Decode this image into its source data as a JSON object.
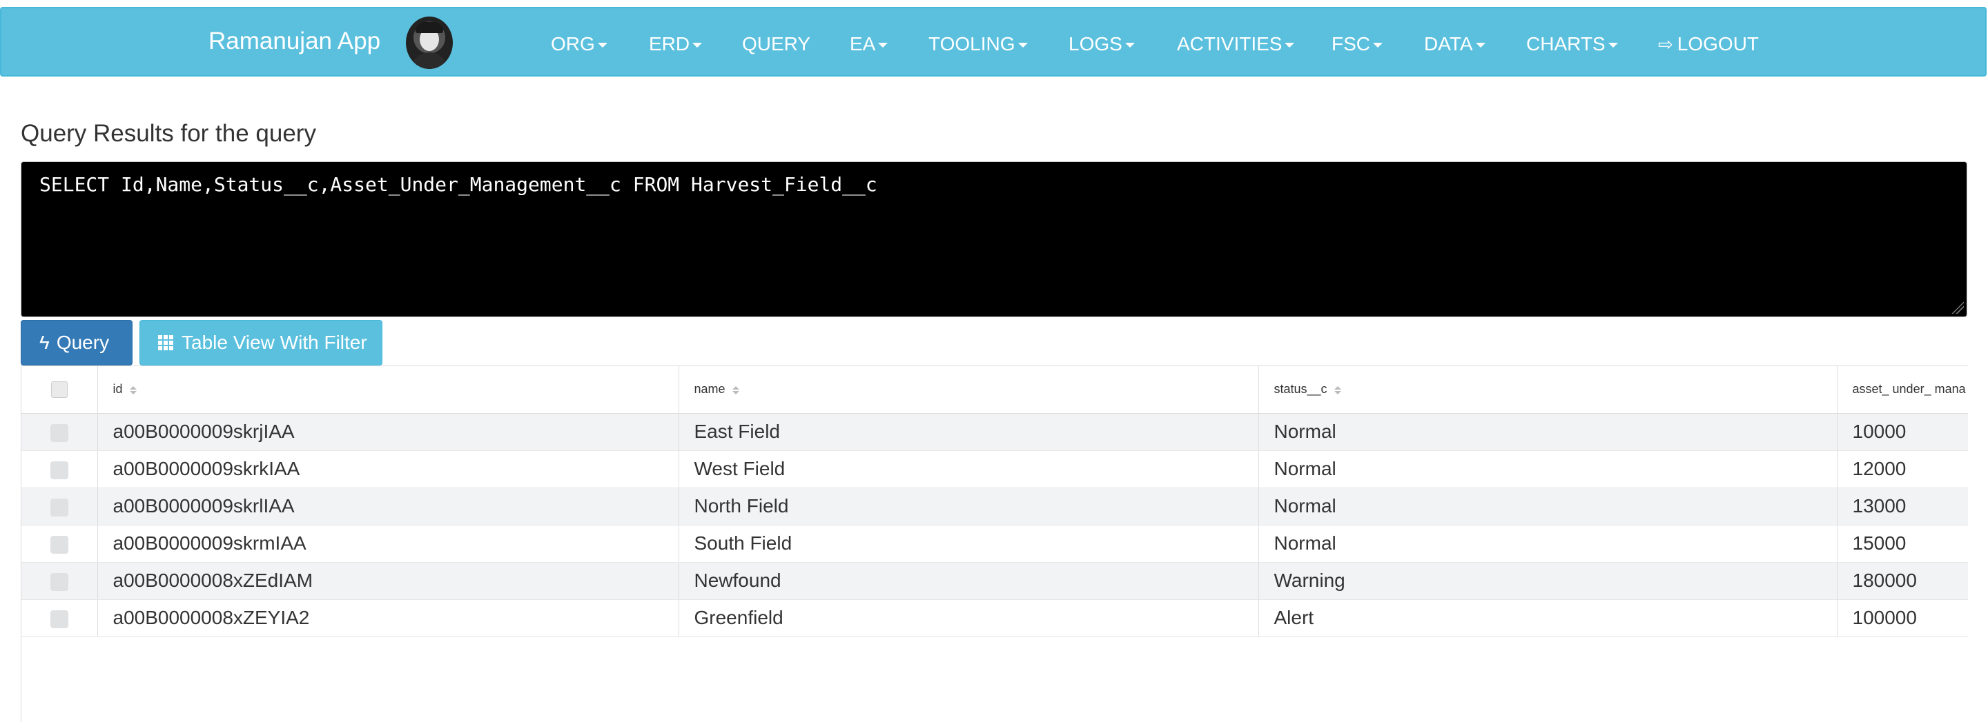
{
  "navbar": {
    "brand": "Ramanujan App",
    "items": [
      {
        "label": "ORG",
        "dropdown": true
      },
      {
        "label": "ERD",
        "dropdown": true
      },
      {
        "label": "QUERY",
        "dropdown": false
      },
      {
        "label": "EA",
        "dropdown": true
      },
      {
        "label": "TOOLING",
        "dropdown": true
      },
      {
        "label": "LOGS",
        "dropdown": true
      },
      {
        "label": "ACTIVITIES",
        "dropdown": true
      },
      {
        "label": "FSC",
        "dropdown": true
      },
      {
        "label": "DATA",
        "dropdown": true
      },
      {
        "label": "CHARTS",
        "dropdown": true
      }
    ],
    "logout": "LOGOUT",
    "color": "#5bc0de"
  },
  "page": {
    "title": "Query Results for the query"
  },
  "editor": {
    "query": "SELECT Id,Name,Status__c,Asset_Under_Management__c FROM Harvest_Field__c"
  },
  "buttons": {
    "query": "Query",
    "table_view": "Table View With Filter"
  },
  "table": {
    "columns": [
      "id",
      "name",
      "status__c",
      "asset_ under_ mana"
    ],
    "rows": [
      [
        "a00B0000009skrjIAA",
        "East Field",
        "Normal",
        "10000"
      ],
      [
        "a00B0000009skrkIAA",
        "West Field",
        "Normal",
        "12000"
      ],
      [
        "a00B0000009skrlIAA",
        "North Field",
        "Normal",
        "13000"
      ],
      [
        "a00B0000009skrmIAA",
        "South Field",
        "Normal",
        "15000"
      ],
      [
        "a00B0000008xZEdIAM",
        "Newfound",
        "Warning",
        "180000"
      ],
      [
        "a00B0000008xZEYIA2",
        "Greenfield",
        "Alert",
        "100000"
      ]
    ]
  }
}
